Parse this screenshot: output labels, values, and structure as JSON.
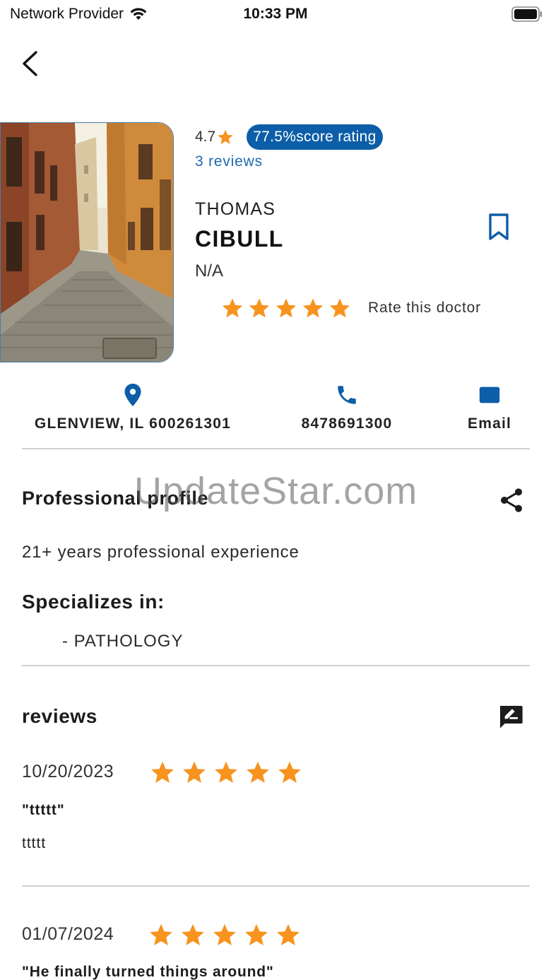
{
  "status_bar": {
    "carrier": "Network Provider",
    "time": "10:33 PM",
    "wifi_icon": "wifi-icon",
    "battery_icon": "battery-icon"
  },
  "nav": {
    "back_icon": "chevron-left-icon"
  },
  "doctor": {
    "rating": "4.7",
    "score_badge": "77.5%score rating",
    "reviews_link": "3 reviews",
    "first_name": "THOMAS",
    "last_name": "CIBULL",
    "specialty": "N/A",
    "rate_label": "Rate this doctor",
    "rate_stars": 5
  },
  "contact": {
    "address": "GLENVIEW, IL 600261301",
    "phone": "8478691300",
    "email_label": "Email"
  },
  "profile": {
    "title": "Professional profile",
    "experience": "21+ years professional experience",
    "specializes_title": "Specializes in:",
    "specializations": [
      "- PATHOLOGY"
    ]
  },
  "reviews_section": {
    "title": "reviews",
    "items": [
      {
        "date": "10/20/2023",
        "stars": 5,
        "title": "\"ttttt\"",
        "body": "ttttt"
      },
      {
        "date": "01/07/2024",
        "stars": 5,
        "title": "\"He finally turned things around\"",
        "body": ""
      }
    ]
  },
  "watermark": "UpdateStar.com",
  "colors": {
    "accent_blue": "#0d5ea8",
    "link_blue": "#1f6bb0",
    "star_orange": "#f7931e",
    "divider": "#d0d0d0"
  }
}
